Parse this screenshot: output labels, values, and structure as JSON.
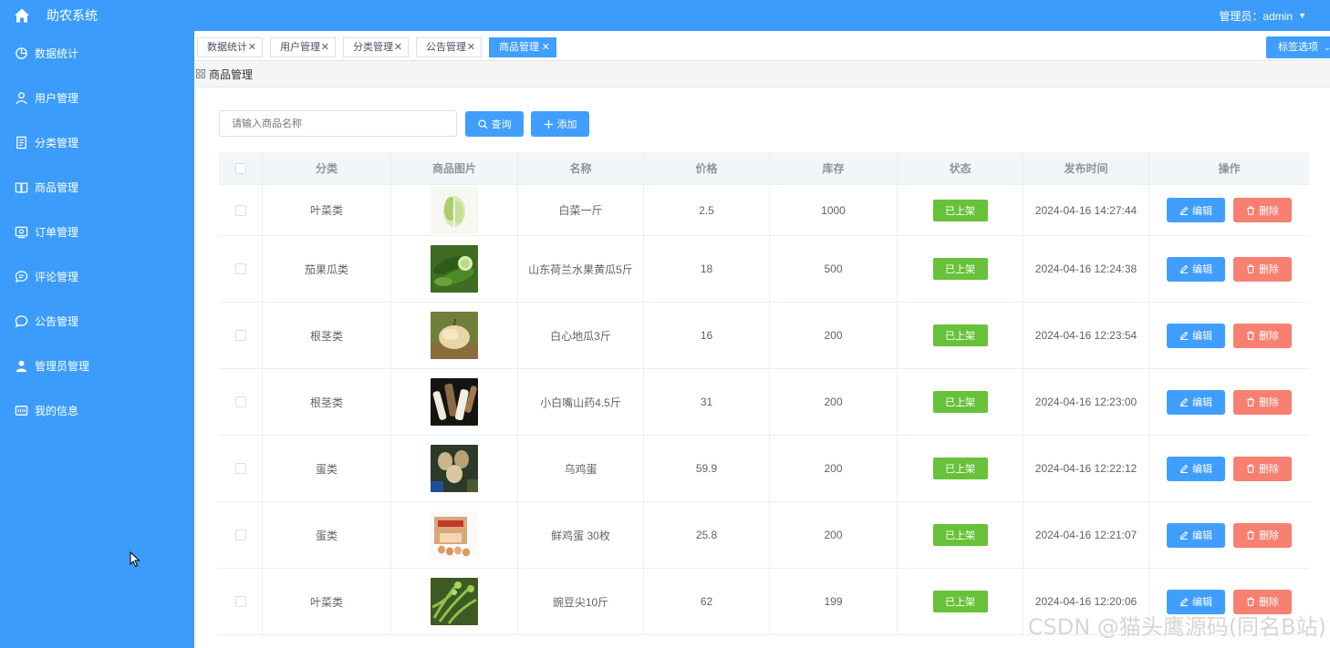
{
  "app": {
    "title": "助农系统",
    "user_label": "管理员：admin"
  },
  "sidebar": {
    "items": [
      {
        "label": "数据统计",
        "icon": "pie-chart-icon"
      },
      {
        "label": "用户管理",
        "icon": "user-icon"
      },
      {
        "label": "分类管理",
        "icon": "document-icon"
      },
      {
        "label": "商品管理",
        "icon": "book-icon"
      },
      {
        "label": "订单管理",
        "icon": "order-icon"
      },
      {
        "label": "评论管理",
        "icon": "comment-icon"
      },
      {
        "label": "公告管理",
        "icon": "chat-icon"
      },
      {
        "label": "管理员管理",
        "icon": "admin-user-icon"
      },
      {
        "label": "我的信息",
        "icon": "info-card-icon"
      }
    ]
  },
  "tabs": {
    "items": [
      {
        "label": "数据统计",
        "active": false
      },
      {
        "label": "用户管理",
        "active": false
      },
      {
        "label": "分类管理",
        "active": false
      },
      {
        "label": "公告管理",
        "active": false
      },
      {
        "label": "商品管理",
        "active": true
      }
    ],
    "options_label": "标签选项"
  },
  "breadcrumb": {
    "label": "商品管理"
  },
  "search": {
    "placeholder": "请输入商品名称",
    "value": "",
    "query_label": "查询",
    "add_label": "添加"
  },
  "table": {
    "headers": [
      "分类",
      "商品图片",
      "名称",
      "价格",
      "库存",
      "状态",
      "发布时间",
      "操作"
    ],
    "rows": [
      {
        "category": "叶菜类",
        "image": "cabbage",
        "name": "白菜一斤",
        "price": "2.5",
        "stock": "1000",
        "status": "已上架",
        "time": "2024-04-16 14:27:44"
      },
      {
        "category": "茄果瓜类",
        "image": "cucumber",
        "name": "山东荷兰水果黄瓜5斤",
        "price": "18",
        "stock": "500",
        "status": "已上架",
        "time": "2024-04-16 12:24:38"
      },
      {
        "category": "根茎类",
        "image": "sweet-potato",
        "name": "白心地瓜3斤",
        "price": "16",
        "stock": "200",
        "status": "已上架",
        "time": "2024-04-16 12:23:54"
      },
      {
        "category": "根茎类",
        "image": "yam",
        "name": "小白嘴山药4.5斤",
        "price": "31",
        "stock": "200",
        "status": "已上架",
        "time": "2024-04-16 12:23:00"
      },
      {
        "category": "蛋类",
        "image": "black-chicken-eggs",
        "name": "乌鸡蛋",
        "price": "59.9",
        "stock": "200",
        "status": "已上架",
        "time": "2024-04-16 12:22:12"
      },
      {
        "category": "蛋类",
        "image": "egg-box",
        "name": "鲜鸡蛋 30枚",
        "price": "25.8",
        "stock": "200",
        "status": "已上架",
        "time": "2024-04-16 12:21:07"
      },
      {
        "category": "叶菜类",
        "image": "pea-shoots",
        "name": "豌豆尖10斤",
        "price": "62",
        "stock": "199",
        "status": "已上架",
        "time": "2024-04-16 12:20:06"
      }
    ],
    "edit_label": "编辑",
    "delete_label": "删除"
  },
  "watermark": "CSDN @猫头鹰源码(同名B站)",
  "colors": {
    "primary": "#409eff",
    "sidebar": "#3b9cfc",
    "success": "#67c23a",
    "danger": "#f78071"
  }
}
